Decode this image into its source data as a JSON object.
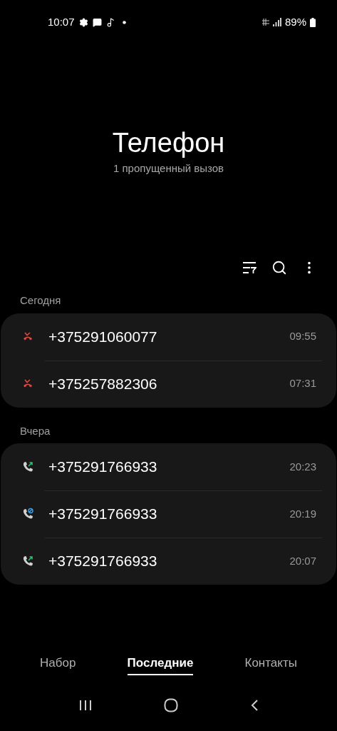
{
  "status_bar": {
    "time": "10:07",
    "battery": "89%"
  },
  "header": {
    "title": "Телефон",
    "subtitle": "1 пропущенный вызов"
  },
  "groups": [
    {
      "label": "Сегодня",
      "calls": [
        {
          "number": "+375291060077",
          "time": "09:55",
          "kind": "missed"
        },
        {
          "number": "+375257882306",
          "time": "07:31",
          "kind": "missed"
        }
      ]
    },
    {
      "label": "Вчера",
      "calls": [
        {
          "number": "+375291766933",
          "time": "20:23",
          "kind": "outgoing"
        },
        {
          "number": "+375291766933",
          "time": "20:19",
          "kind": "blocked"
        },
        {
          "number": "+375291766933",
          "time": "20:07",
          "kind": "outgoing"
        }
      ]
    }
  ],
  "tabs": [
    {
      "label": "Набор",
      "selected": false
    },
    {
      "label": "Последние",
      "selected": true
    },
    {
      "label": "Контакты",
      "selected": false
    }
  ]
}
